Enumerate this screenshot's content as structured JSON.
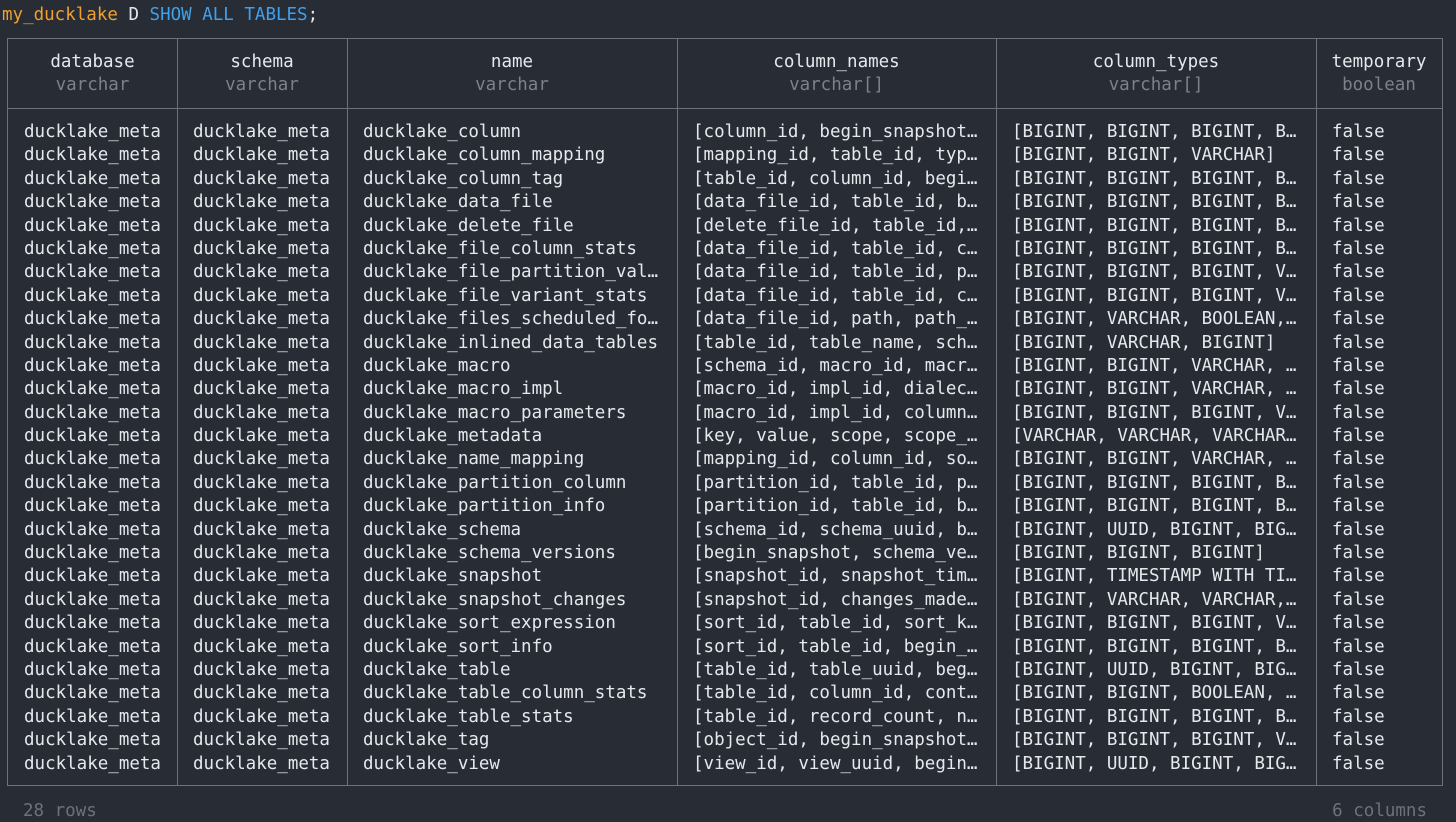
{
  "prompt": {
    "database": "my_ducklake",
    "mode": "D",
    "command": "SHOW ALL TABLES",
    "terminator": ";"
  },
  "table": {
    "columns": [
      {
        "name": "database",
        "type": "varchar"
      },
      {
        "name": "schema",
        "type": "varchar"
      },
      {
        "name": "name",
        "type": "varchar"
      },
      {
        "name": "column_names",
        "type": "varchar[]"
      },
      {
        "name": "column_types",
        "type": "varchar[]"
      },
      {
        "name": "temporary",
        "type": "boolean"
      }
    ],
    "rows": [
      [
        "ducklake_meta",
        "ducklake_meta",
        "ducklake_column",
        "[column_id, begin_snapshot…",
        "[BIGINT, BIGINT, BIGINT, B…",
        "false"
      ],
      [
        "ducklake_meta",
        "ducklake_meta",
        "ducklake_column_mapping",
        "[mapping_id, table_id, typ…",
        "[BIGINT, BIGINT, VARCHAR]",
        "false"
      ],
      [
        "ducklake_meta",
        "ducklake_meta",
        "ducklake_column_tag",
        "[table_id, column_id, begi…",
        "[BIGINT, BIGINT, BIGINT, B…",
        "false"
      ],
      [
        "ducklake_meta",
        "ducklake_meta",
        "ducklake_data_file",
        "[data_file_id, table_id, b…",
        "[BIGINT, BIGINT, BIGINT, B…",
        "false"
      ],
      [
        "ducklake_meta",
        "ducklake_meta",
        "ducklake_delete_file",
        "[delete_file_id, table_id,…",
        "[BIGINT, BIGINT, BIGINT, B…",
        "false"
      ],
      [
        "ducklake_meta",
        "ducklake_meta",
        "ducklake_file_column_stats",
        "[data_file_id, table_id, c…",
        "[BIGINT, BIGINT, BIGINT, B…",
        "false"
      ],
      [
        "ducklake_meta",
        "ducklake_meta",
        "ducklake_file_partition_val…",
        "[data_file_id, table_id, p…",
        "[BIGINT, BIGINT, BIGINT, V…",
        "false"
      ],
      [
        "ducklake_meta",
        "ducklake_meta",
        "ducklake_file_variant_stats",
        "[data_file_id, table_id, c…",
        "[BIGINT, BIGINT, BIGINT, V…",
        "false"
      ],
      [
        "ducklake_meta",
        "ducklake_meta",
        "ducklake_files_scheduled_fo…",
        "[data_file_id, path, path_…",
        "[BIGINT, VARCHAR, BOOLEAN,…",
        "false"
      ],
      [
        "ducklake_meta",
        "ducklake_meta",
        "ducklake_inlined_data_tables",
        "[table_id, table_name, sch…",
        "[BIGINT, VARCHAR, BIGINT]",
        "false"
      ],
      [
        "ducklake_meta",
        "ducklake_meta",
        "ducklake_macro",
        "[schema_id, macro_id, macr…",
        "[BIGINT, BIGINT, VARCHAR, …",
        "false"
      ],
      [
        "ducklake_meta",
        "ducklake_meta",
        "ducklake_macro_impl",
        "[macro_id, impl_id, dialec…",
        "[BIGINT, BIGINT, VARCHAR, …",
        "false"
      ],
      [
        "ducklake_meta",
        "ducklake_meta",
        "ducklake_macro_parameters",
        "[macro_id, impl_id, column…",
        "[BIGINT, BIGINT, BIGINT, V…",
        "false"
      ],
      [
        "ducklake_meta",
        "ducklake_meta",
        "ducklake_metadata",
        "[key, value, scope, scope_…",
        "[VARCHAR, VARCHAR, VARCHAR…",
        "false"
      ],
      [
        "ducklake_meta",
        "ducklake_meta",
        "ducklake_name_mapping",
        "[mapping_id, column_id, so…",
        "[BIGINT, BIGINT, VARCHAR, …",
        "false"
      ],
      [
        "ducklake_meta",
        "ducklake_meta",
        "ducklake_partition_column",
        "[partition_id, table_id, p…",
        "[BIGINT, BIGINT, BIGINT, B…",
        "false"
      ],
      [
        "ducklake_meta",
        "ducklake_meta",
        "ducklake_partition_info",
        "[partition_id, table_id, b…",
        "[BIGINT, BIGINT, BIGINT, B…",
        "false"
      ],
      [
        "ducklake_meta",
        "ducklake_meta",
        "ducklake_schema",
        "[schema_id, schema_uuid, b…",
        "[BIGINT, UUID, BIGINT, BIG…",
        "false"
      ],
      [
        "ducklake_meta",
        "ducklake_meta",
        "ducklake_schema_versions",
        "[begin_snapshot, schema_ve…",
        "[BIGINT, BIGINT, BIGINT]",
        "false"
      ],
      [
        "ducklake_meta",
        "ducklake_meta",
        "ducklake_snapshot",
        "[snapshot_id, snapshot_tim…",
        "[BIGINT, TIMESTAMP WITH TI…",
        "false"
      ],
      [
        "ducklake_meta",
        "ducklake_meta",
        "ducklake_snapshot_changes",
        "[snapshot_id, changes_made…",
        "[BIGINT, VARCHAR, VARCHAR,…",
        "false"
      ],
      [
        "ducklake_meta",
        "ducklake_meta",
        "ducklake_sort_expression",
        "[sort_id, table_id, sort_k…",
        "[BIGINT, BIGINT, BIGINT, V…",
        "false"
      ],
      [
        "ducklake_meta",
        "ducklake_meta",
        "ducklake_sort_info",
        "[sort_id, table_id, begin_…",
        "[BIGINT, BIGINT, BIGINT, B…",
        "false"
      ],
      [
        "ducklake_meta",
        "ducklake_meta",
        "ducklake_table",
        "[table_id, table_uuid, beg…",
        "[BIGINT, UUID, BIGINT, BIG…",
        "false"
      ],
      [
        "ducklake_meta",
        "ducklake_meta",
        "ducklake_table_column_stats",
        "[table_id, column_id, cont…",
        "[BIGINT, BIGINT, BOOLEAN, …",
        "false"
      ],
      [
        "ducklake_meta",
        "ducklake_meta",
        "ducklake_table_stats",
        "[table_id, record_count, n…",
        "[BIGINT, BIGINT, BIGINT, B…",
        "false"
      ],
      [
        "ducklake_meta",
        "ducklake_meta",
        "ducklake_tag",
        "[object_id, begin_snapshot…",
        "[BIGINT, BIGINT, BIGINT, V…",
        "false"
      ],
      [
        "ducklake_meta",
        "ducklake_meta",
        "ducklake_view",
        "[view_id, view_uuid, begin…",
        "[BIGINT, UUID, BIGINT, BIG…",
        "false"
      ]
    ]
  },
  "footer": {
    "rows_label": "28 rows",
    "columns_label": "6 columns"
  }
}
